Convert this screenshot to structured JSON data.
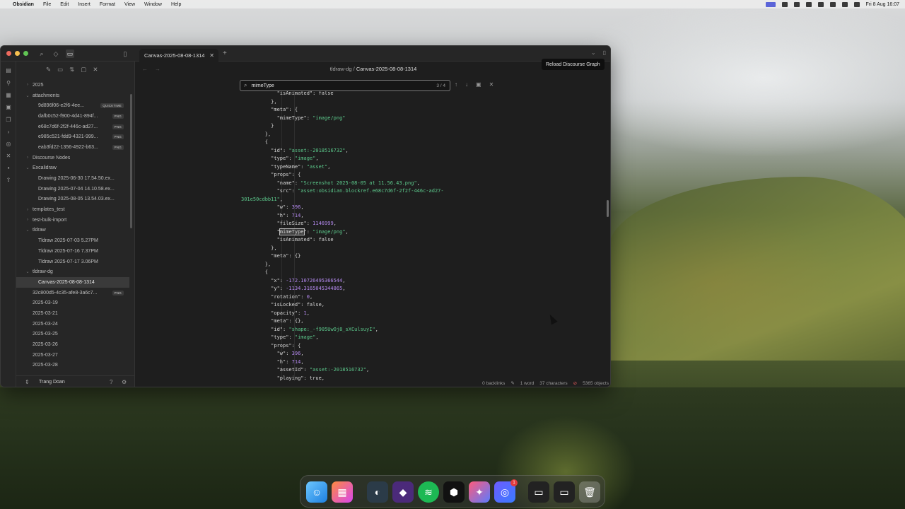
{
  "menubar": {
    "app": "Obsidian",
    "items": [
      "File",
      "Edit",
      "Insert",
      "Format",
      "View",
      "Window",
      "Help"
    ],
    "datetime": "Fri 8 Aug 16:07"
  },
  "tab": {
    "title": "Canvas-2025-08-08-1314"
  },
  "breadcrumb": {
    "folder": "tldraw-dg",
    "sep": "/",
    "file": "Canvas-2025-08-08-1314"
  },
  "search": {
    "query": "mimeType",
    "count": "3 / 4"
  },
  "tooltip": "Reload Discourse Graph",
  "explorer": {
    "rows": [
      {
        "label": "2025",
        "level": 0,
        "chev": "›"
      },
      {
        "label": "attachments",
        "level": 0,
        "chev": "⌄"
      },
      {
        "label": "9d896f06-e2f6-4ee...",
        "level": 1,
        "badge": "QUICKTIME"
      },
      {
        "label": "dafb0c52-f900-4d41-894f...",
        "level": 1,
        "badge": "PNG"
      },
      {
        "label": "e68c7d6f-2f2f-446c-ad27...",
        "level": 1,
        "badge": "PNG"
      },
      {
        "label": "e985c521-fdd9-4321-999...",
        "level": 1,
        "badge": "PNG"
      },
      {
        "label": "eab3fd22-1356-4922-b63...",
        "level": 1,
        "badge": "PNG"
      },
      {
        "label": "Discourse Nodes",
        "level": 0,
        "chev": "›"
      },
      {
        "label": "Excalidraw",
        "level": 0,
        "chev": "⌄"
      },
      {
        "label": "Drawing 2025-06-30 17.54.50.ex...",
        "level": 1
      },
      {
        "label": "Drawing 2025-07-04 14.10.58.ex...",
        "level": 1
      },
      {
        "label": "Drawing 2025-08-05 13.54.03.ex...",
        "level": 1
      },
      {
        "label": "templates_test",
        "level": 0,
        "chev": "›"
      },
      {
        "label": "test-bulk-import",
        "level": 0,
        "chev": "›"
      },
      {
        "label": "tldraw",
        "level": 0,
        "chev": "⌄"
      },
      {
        "label": "Tldraw 2025-07-03 5.27PM",
        "level": 1
      },
      {
        "label": "Tldraw 2025-07-16 7.37PM",
        "level": 1
      },
      {
        "label": "Tldraw 2025-07-17 3.06PM",
        "level": 1
      },
      {
        "label": "tldraw-dg",
        "level": 0,
        "chev": "⌄"
      },
      {
        "label": "Canvas-2025-08-08-1314",
        "level": 1,
        "active": true
      },
      {
        "label": "32c800d5-4c35-afe8-3a6c7...",
        "level": 0,
        "badge": "PNG"
      },
      {
        "label": "2025-03-19",
        "level": 0
      },
      {
        "label": "2025-03-21",
        "level": 0
      },
      {
        "label": "2025-03-24",
        "level": 0
      },
      {
        "label": "2025-03-25",
        "level": 0
      },
      {
        "label": "2025-03-26",
        "level": 0
      },
      {
        "label": "2025-03-27",
        "level": 0
      },
      {
        "label": "2025-03-28",
        "level": 0
      }
    ],
    "user": "Trang Doan"
  },
  "code_lines": [
    [
      {
        "t": "            \"isAnimated\": false",
        "c": "k"
      }
    ],
    [
      {
        "t": "          },",
        "c": "k"
      }
    ],
    [
      {
        "t": "          \"meta\": {",
        "c": "k"
      }
    ],
    [
      {
        "t": "            \"mimeType\": ",
        "c": "k"
      },
      {
        "t": "\"image/png\"",
        "c": "s"
      }
    ],
    [
      {
        "t": "          }",
        "c": "k"
      }
    ],
    [
      {
        "t": "        },",
        "c": "k"
      }
    ],
    [
      {
        "t": "        {",
        "c": "k"
      }
    ],
    [
      {
        "t": "          \"id\": ",
        "c": "k"
      },
      {
        "t": "\"asset:-2018516732\"",
        "c": "s"
      },
      {
        "t": ",",
        "c": "k"
      }
    ],
    [
      {
        "t": "          \"type\": ",
        "c": "k"
      },
      {
        "t": "\"image\"",
        "c": "s"
      },
      {
        "t": ",",
        "c": "k"
      }
    ],
    [
      {
        "t": "          \"typeName\": ",
        "c": "k"
      },
      {
        "t": "\"asset\"",
        "c": "s"
      },
      {
        "t": ",",
        "c": "k"
      }
    ],
    [
      {
        "t": "          \"props\": {",
        "c": "k"
      }
    ],
    [
      {
        "t": "            \"name\": ",
        "c": "k"
      },
      {
        "t": "\"Screenshot 2025-08-05 at 11.56.43.png\"",
        "c": "s"
      },
      {
        "t": ",",
        "c": "k"
      }
    ],
    [
      {
        "t": "            \"src\": ",
        "c": "k"
      },
      {
        "t": "\"asset:obsidian.blockref.e68c7d6f-2f2f-446c-ad27-",
        "c": "s"
      }
    ],
    [
      {
        "t": "301e50cdbb11\"",
        "c": "s"
      },
      {
        "t": ",",
        "c": "k"
      }
    ],
    [
      {
        "t": "            \"w\": ",
        "c": "k"
      },
      {
        "t": "396",
        "c": "n"
      },
      {
        "t": ",",
        "c": "k"
      }
    ],
    [
      {
        "t": "            \"h\": ",
        "c": "k"
      },
      {
        "t": "714",
        "c": "n"
      },
      {
        "t": ",",
        "c": "k"
      }
    ],
    [
      {
        "t": "            \"fileSize\": ",
        "c": "k"
      },
      {
        "t": "1146999",
        "c": "n"
      },
      {
        "t": ",",
        "c": "k"
      }
    ],
    [
      {
        "t": "            \"",
        "c": "k"
      },
      {
        "t": "mimeType",
        "c": "k",
        "hl": true
      },
      {
        "t": "\": ",
        "c": "k"
      },
      {
        "t": "\"image/png\"",
        "c": "s"
      },
      {
        "t": ",",
        "c": "k"
      }
    ],
    [
      {
        "t": "            \"isAnimated\": false",
        "c": "k"
      }
    ],
    [
      {
        "t": "          },",
        "c": "k"
      }
    ],
    [
      {
        "t": "          \"meta\": {}",
        "c": "k"
      }
    ],
    [
      {
        "t": "        },",
        "c": "k"
      }
    ],
    [
      {
        "t": "        {",
        "c": "k"
      }
    ],
    [
      {
        "t": "          \"x\": ",
        "c": "k"
      },
      {
        "t": "-172.10726495366544",
        "c": "n"
      },
      {
        "t": ",",
        "c": "k"
      }
    ],
    [
      {
        "t": "          \"y\": ",
        "c": "k"
      },
      {
        "t": "-1134.3165045344865",
        "c": "n"
      },
      {
        "t": ",",
        "c": "k"
      }
    ],
    [
      {
        "t": "          \"rotation\": ",
        "c": "k"
      },
      {
        "t": "0",
        "c": "n"
      },
      {
        "t": ",",
        "c": "k"
      }
    ],
    [
      {
        "t": "          \"isLocked\": false,",
        "c": "k"
      }
    ],
    [
      {
        "t": "          \"opacity\": ",
        "c": "k"
      },
      {
        "t": "1",
        "c": "n"
      },
      {
        "t": ",",
        "c": "k"
      }
    ],
    [
      {
        "t": "          \"meta\": {},",
        "c": "k"
      }
    ],
    [
      {
        "t": "          \"id\": ",
        "c": "k"
      },
      {
        "t": "\"shape:_-f905UwOj8_sXCulsuyI\"",
        "c": "s"
      },
      {
        "t": ",",
        "c": "k"
      }
    ],
    [
      {
        "t": "          \"type\": ",
        "c": "k"
      },
      {
        "t": "\"image\"",
        "c": "s"
      },
      {
        "t": ",",
        "c": "k"
      }
    ],
    [
      {
        "t": "          \"props\": {",
        "c": "k"
      }
    ],
    [
      {
        "t": "            \"w\": ",
        "c": "k"
      },
      {
        "t": "396",
        "c": "n"
      },
      {
        "t": ",",
        "c": "k"
      }
    ],
    [
      {
        "t": "            \"h\": ",
        "c": "k"
      },
      {
        "t": "714",
        "c": "n"
      },
      {
        "t": ",",
        "c": "k"
      }
    ],
    [
      {
        "t": "            \"assetId\": ",
        "c": "k"
      },
      {
        "t": "\"asset:-2018516732\"",
        "c": "s"
      },
      {
        "t": ",",
        "c": "k"
      }
    ],
    [
      {
        "t": "            \"playing\": true,",
        "c": "k"
      }
    ],
    [
      {
        "t": "            \"url\": ",
        "c": "k"
      },
      {
        "t": "\"\"",
        "c": "s"
      },
      {
        "t": ",",
        "c": "k"
      }
    ]
  ],
  "status": {
    "backlinks": "0 backlinks",
    "words": "1 word",
    "chars": "37 characters",
    "objects": "5365 objects"
  },
  "dock": {
    "icons": [
      "finder-icon",
      "launchpad-icon",
      "figma-icon",
      "obsidian-icon",
      "spotify-icon",
      "cursor-icon",
      "toolbox-icon",
      "screenshot-icon",
      "window-icon",
      "window-icon-2",
      "trash-icon"
    ],
    "notification": "1"
  },
  "colors": {
    "accent": "#5b64d8",
    "string": "#5cc88b",
    "number": "#b58af0"
  }
}
